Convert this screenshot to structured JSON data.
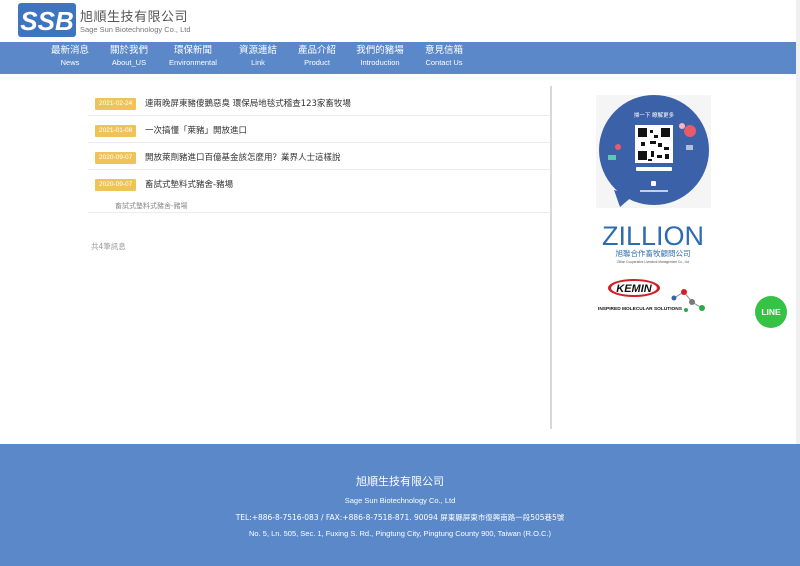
{
  "header": {
    "company_cn": "旭順生技有限公司",
    "company_en": "Sage Sun Biotechnology Co., Ltd",
    "logo_letters": "SSB"
  },
  "nav": [
    {
      "cn": "最新消息",
      "en": "News"
    },
    {
      "cn": "關於我們",
      "en": "About_US"
    },
    {
      "cn": "環保新聞",
      "en": "Environmental"
    },
    {
      "cn": "資源連結",
      "en": "Link"
    },
    {
      "cn": "產品介紹",
      "en": "Product"
    },
    {
      "cn": "我們的豬場",
      "en": "Introduction"
    },
    {
      "cn": "意見信箱",
      "en": "Contact Us"
    }
  ],
  "news": [
    {
      "date": "2021-02-24",
      "title": "連兩晚屏東豬傻鵝惡臭 環保局地毯式稽查123家畜牧場"
    },
    {
      "date": "2021-01-08",
      "title": "一次搞懂「萊豬」開放進口"
    },
    {
      "date": "2020-09-07",
      "title": "開放萊劑豬進口百億基金該怎麼用？業界人士這樣說"
    },
    {
      "date": "2020-09-07",
      "title": "畜試式墊料式豬舍-豬場"
    }
  ],
  "news_sub": "畜試式墊料式豬舍-豬場",
  "total_text": "共4筆訊息",
  "sidebar": {
    "qr_caption": "掃一下 瞭解更多",
    "zillion_word": "ZILLION",
    "zillion_cn": "旭聯合作畜牧顧問公司",
    "zillion_en": "Zillion Cooperative Livestock Management Co., Ltd",
    "kemin_word": "KEMIN",
    "kemin_tagline": "INSPIRED MOLECULAR SOLUTIONS"
  },
  "line_label": "LINE",
  "footer": {
    "company_cn": "旭順生技有限公司",
    "company_en": "Sage Sun Biotechnology Co., Ltd",
    "tel": "TEL:+886-8-7516-083 / FAX:+886-8-7518-871.   90094 屏東縣屏東市復興南路一段505巷5號",
    "address_en": "No. 5, Ln. 505, Sec. 1, Fuxing S. Rd., Pingtung City, Pingtung County 900, Taiwan (R.O.C.)"
  },
  "colors": {
    "brand_blue": "#5a88c8",
    "date_badge": "#efc35a",
    "line_green": "#36c244"
  }
}
